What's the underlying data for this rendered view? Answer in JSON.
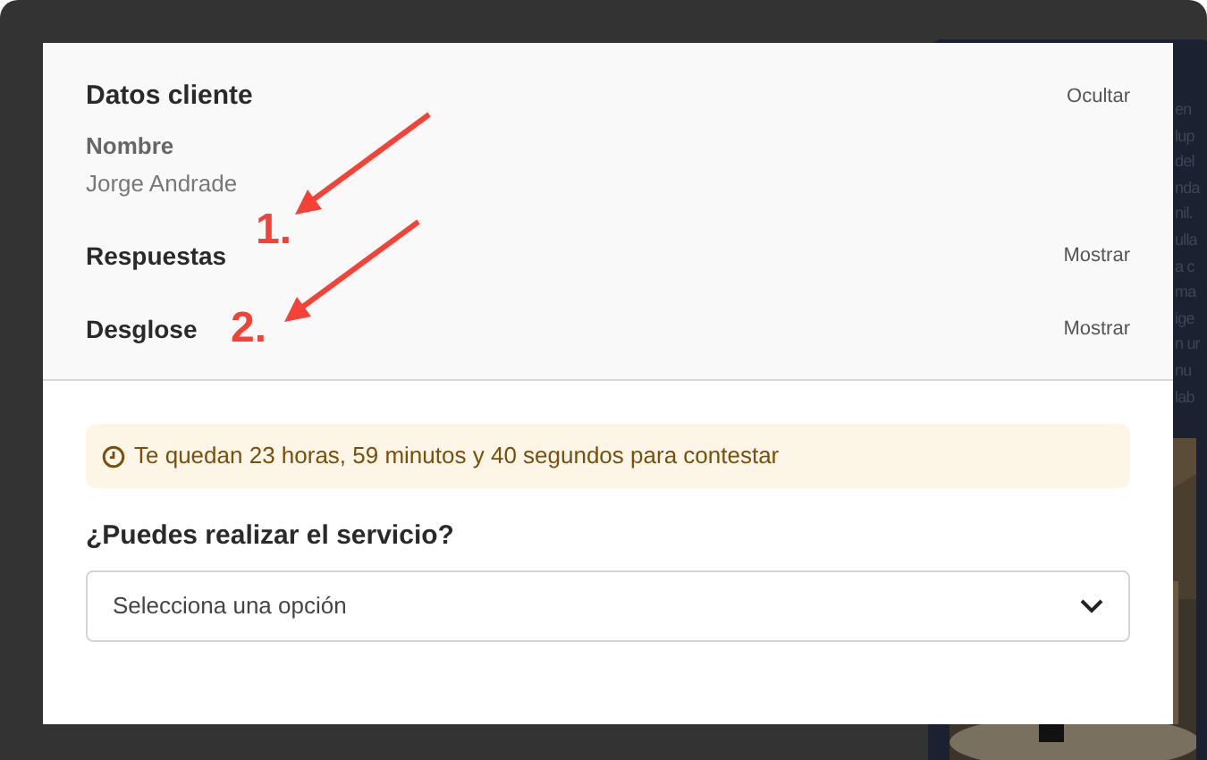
{
  "background_panel": {
    "text_fragments": [
      "en",
      "lup",
      "del",
      "nda",
      "nil.",
      "ulla",
      "a c",
      "ma",
      "ige",
      "n ur",
      "nu",
      "lab"
    ]
  },
  "modal": {
    "customer_section": {
      "title": "Datos cliente",
      "toggle": "Ocultar",
      "fields": [
        {
          "label": "Nombre",
          "value": "Jorge Andrade"
        }
      ]
    },
    "sections": [
      {
        "title": "Respuestas",
        "toggle": "Mostrar",
        "annotation": "1."
      },
      {
        "title": "Desglose",
        "toggle": "Mostrar",
        "annotation": "2."
      }
    ],
    "timer_notice": "Te quedan 23 horas, 59 minutos y 40 segundos para contestar",
    "question": {
      "label": "¿Puedes realizar el servicio?",
      "placeholder": "Selecciona una opción"
    }
  }
}
